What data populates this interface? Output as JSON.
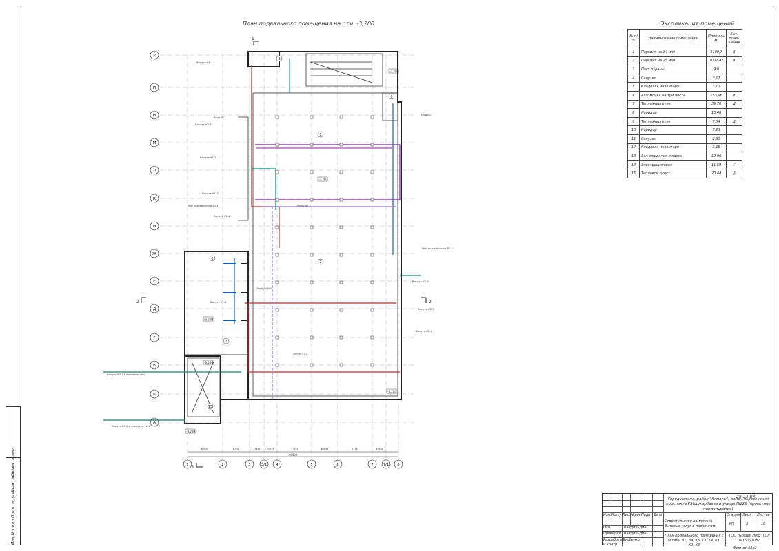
{
  "drawing": {
    "plan_title": "План подвального помещения на отм. -3,200",
    "expl_title": "Экспликация помещений",
    "corner_code": "28-23-ВК",
    "format": "Формат    А3х2"
  },
  "explication": {
    "headers": [
      "№ п/п",
      "Наименование помещения",
      "Площадь м²",
      "Кат. поме-щения"
    ],
    "rows": [
      [
        "1",
        "Паркинг на 34 м/м",
        "1189,7",
        "В"
      ],
      [
        "2",
        "Паркинг на 25 м/м",
        "1007,42",
        "В"
      ],
      [
        "3",
        "Пост охраны",
        "9,0",
        ""
      ],
      [
        "4",
        "Санузел",
        "3,17",
        ""
      ],
      [
        "5",
        "Кладовая инвентаря",
        "3,17",
        ""
      ],
      [
        "6",
        "Автомойка на три поста",
        "153,96",
        "В"
      ],
      [
        "7",
        "Теплоэнергетик",
        "39,70",
        "Д"
      ],
      [
        "8",
        "Коридор",
        "10,48",
        ""
      ],
      [
        "9",
        "Теплоэнергетик",
        "7,34",
        "Д"
      ],
      [
        "10",
        "Коридор",
        "5,23",
        ""
      ],
      [
        "11",
        "Санузел",
        "2,65",
        ""
      ],
      [
        "12",
        "Кладовая инвентаря",
        "3,16",
        ""
      ],
      [
        "13",
        "Зал ожидания и касса",
        "19,06",
        ""
      ],
      [
        "14",
        "Электрощитовая",
        "11,59",
        "Г"
      ],
      [
        "15",
        "Тепловой пункт",
        "20,44",
        "Д"
      ]
    ]
  },
  "axes": {
    "rows": [
      "Р",
      "П",
      "Н",
      "М",
      "Л",
      "К",
      "И",
      "Ж",
      "Е",
      "Д",
      "Г",
      "В",
      "Б",
      "А"
    ],
    "cols": [
      "1",
      "2",
      "3",
      "3/1",
      "4",
      "5",
      "6",
      "7",
      "7/1",
      "8"
    ],
    "bottom_dims": [
      "6000",
      "3200",
      "2100",
      "6000",
      "7200",
      "6000",
      "2100",
      "3200"
    ],
    "bottom_total": "49400",
    "section_marks": [
      "1",
      "1",
      "2",
      "2"
    ]
  },
  "plan_labels": {
    "room_numbers": [
      "1",
      "2",
      "3",
      "6",
      "7",
      "9",
      "15"
    ],
    "levels": [
      "-3,200",
      "-3,200",
      "-3,200",
      "-3,200",
      "-3,200",
      "-3,200"
    ],
    "notes": [
      "Выпуск К1-1",
      "Выпуск К1-2",
      "Выпуск К1-3",
      "Выпуск К1-4",
      "Выпуск К1-5",
      "Ввод В1",
      "Ввод В1",
      "Трап Ду100",
      "Лоток ЛТ-1",
      "Лоток ЛТ-1",
      "Выпуск К3-1 в ливневую сеть",
      "Выпуск К3-2 в ливневую сеть",
      "Мой водосбросной В1-1",
      "Мой водосбросной В1-2",
      "Выпуск К3-3",
      "Выпуск К2-3",
      "Выпуск К2-4",
      "Выпуск К2-5"
    ]
  },
  "stamp": {
    "code": "28-23-ВК",
    "project": "Город Астана, район \"Алматы\", район пересечения проспекта Р.Кошкарбаева и улицы №226 (проектное наименование)",
    "object": "Строительство комплекса бытовых услуг с паркингом",
    "stage_label": "Стадия",
    "sheet_label": "Лист",
    "sheets_label": "Листов",
    "stage": "РП",
    "sheet": "3",
    "sheets": "16",
    "sheet_title": "План подвального помещения с сетями В1, В4, К5, Т3, Т4, К1, К2, К3",
    "company": "ТОО \"Golden Hind\" ГСЛ №15007087",
    "cols": [
      "Изм.",
      "Кол.уч",
      "Лист",
      "№док.",
      "Подп.",
      "Дата"
    ],
    "roles": [
      "ГИП",
      "Проверил",
      "Разработал",
      "н.контр"
    ],
    "names": [
      "Шайдильдин",
      "Шайдильдин",
      "Бурбенко",
      ""
    ]
  },
  "left_strip": [
    "Согласовано",
    "Инв.№ подл.",
    "Подп. и дата",
    "Взам. инв.№"
  ]
}
